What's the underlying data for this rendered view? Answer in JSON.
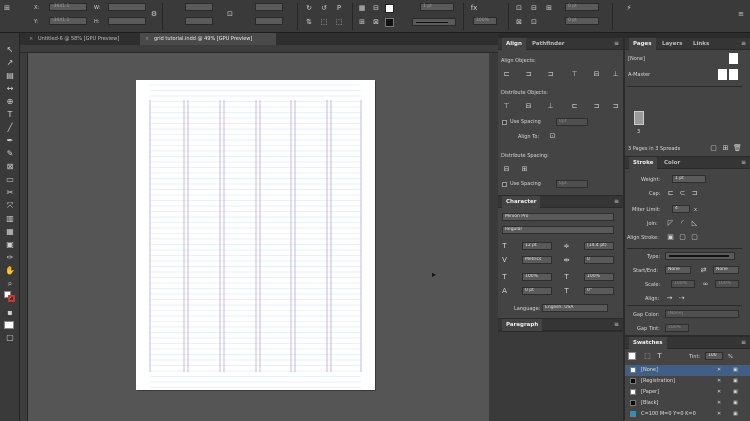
{
  "control_bar": {
    "x_label": "X:",
    "y_label": "Y:",
    "w_label": "W:",
    "h_label": "H:",
    "x_value": "-3641.1",
    "y_value": "-3641.1",
    "stroke_weight": "1 pt",
    "opacity": "100%",
    "frame_value": "0 pt",
    "corner_value": "0 pt",
    "scale_value": "100%"
  },
  "doc_tabs": [
    {
      "label": "Untitled-6 @ 58% [GPU Preview]",
      "active": false
    },
    {
      "label": "grid tutorial.indd @ 49% [GPU Preview]",
      "active": true
    }
  ],
  "align_panel": {
    "tabs": [
      "Align",
      "Pathfinder"
    ],
    "align_objects": "Align Objects:",
    "distribute_objects": "Distribute Objects:",
    "use_spacing": "Use Spacing",
    "spacing_value": "0pt",
    "align_to": "Align To:",
    "distribute_spacing": "Distribute Spacing:",
    "use_spacing2": "Use Spacing",
    "spacing_value2": "0pt"
  },
  "character_panel": {
    "title": "Character",
    "font_family": "Minion Pro",
    "font_style": "Regular",
    "size": "12 pt",
    "leading": "(14.4 pt)",
    "kerning": "Metrics",
    "tracking": "0",
    "vscale": "100%",
    "hscale": "100%",
    "baseline": "0 pt",
    "skew": "0°",
    "language_label": "Language:",
    "language": "English: USA"
  },
  "paragraph_panel": {
    "title": "Paragraph"
  },
  "pages_panel": {
    "tabs": [
      "Pages",
      "Layers",
      "Links"
    ],
    "none_label": "[None]",
    "master_label": "A-Master",
    "page_number": "3",
    "summary": "3 Pages in 3 Spreads"
  },
  "stroke_panel": {
    "tabs": [
      "Stroke",
      "Color"
    ],
    "weight_label": "Weight:",
    "weight": "1 pt",
    "cap_label": "Cap:",
    "miter_label": "Miter Limit:",
    "miter": "4",
    "miter_x": "x",
    "join_label": "Join:",
    "align_label": "Align Stroke:",
    "type_label": "Type:",
    "startend_label": "Start/End:",
    "start_value": "None",
    "end_value": "None",
    "scale_label": "Scale:",
    "scale_start": "100%",
    "scale_end": "100%",
    "align2_label": "Align:",
    "gapcolor_label": "Gap Color:",
    "gapcolor_value": "[None]",
    "gaptint_label": "Gap Tint:",
    "gaptint_value": "100%"
  },
  "swatches_panel": {
    "title": "Swatches",
    "tint_label": "Tint:",
    "tint_value": "100",
    "tint_unit": "%",
    "items": [
      {
        "name": "[None]",
        "color": "#ffffff",
        "selected": true
      },
      {
        "name": "[Registration]",
        "color": "#000000",
        "selected": false
      },
      {
        "name": "[Paper]",
        "color": "#ffffff",
        "selected": false
      },
      {
        "name": "[Black]",
        "color": "#000000",
        "selected": false
      },
      {
        "name": "C=100 M=0 Y=0 K=0",
        "color": "#00a0e6",
        "selected": false
      }
    ]
  },
  "colors": {
    "ui_dark": "#3a3a3a",
    "pasteboard": "#555555",
    "page": "#ffffff",
    "baseline_grid": "#cfe6f4",
    "column_guide": "#b9a6d6",
    "selection": "#3f5f86"
  }
}
